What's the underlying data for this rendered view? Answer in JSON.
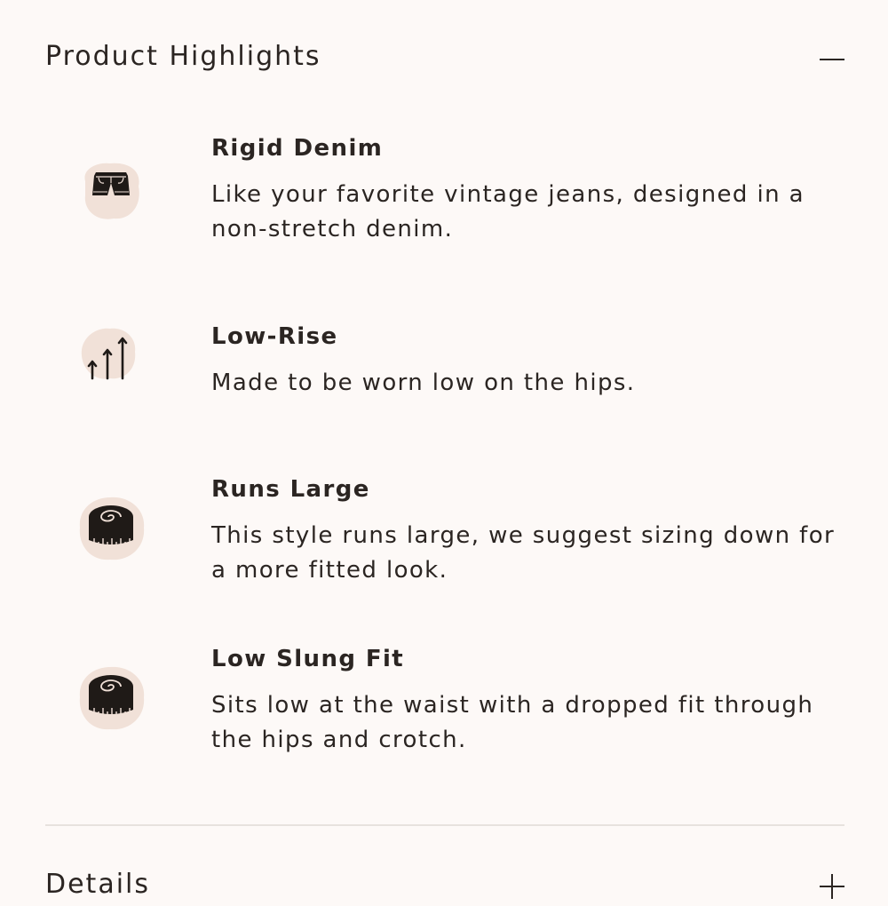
{
  "highlights": {
    "title": "Product Highlights",
    "toggle_icon": "minus-icon",
    "items": [
      {
        "icon": "shorts-icon",
        "title": "Rigid Denim",
        "description": "Like your favorite vintage jeans, designed in a non-stretch denim."
      },
      {
        "icon": "rise-arrows-icon",
        "title": "Low-Rise",
        "description": "Made to be worn low on the hips."
      },
      {
        "icon": "measuring-tape-icon",
        "title": "Runs Large",
        "description": "This style runs large, we suggest sizing down for a more fitted look."
      },
      {
        "icon": "measuring-tape-icon",
        "title": "Low Slung Fit",
        "description": "Sits low at the waist with a dropped fit through the hips and crotch."
      }
    ]
  },
  "details": {
    "title": "Details",
    "toggle_icon": "plus-icon"
  },
  "colors": {
    "background": "#fdf9f7",
    "icon_blob": "#f1e1d8",
    "text": "#2b2522",
    "divider": "#e7e2de"
  }
}
